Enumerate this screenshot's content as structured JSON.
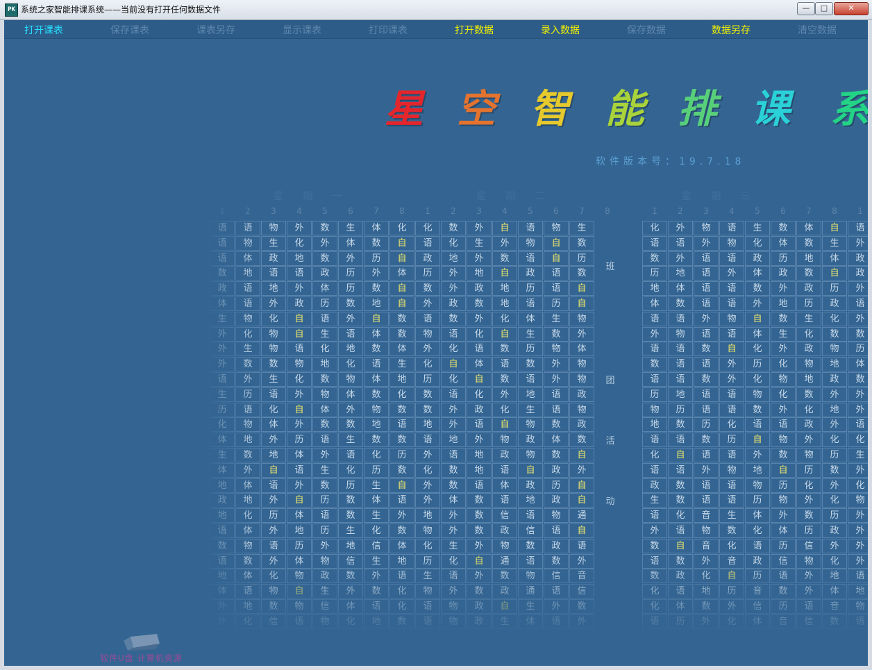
{
  "window": {
    "title": "系统之家智能排课系统——当前没有打开任何数据文件",
    "icon_label": "PK",
    "minimize_glyph": "—",
    "maximize_glyph": "□",
    "close_glyph": "✕"
  },
  "menu": [
    {
      "label": "打开课表",
      "enabled": true,
      "color": "#27e0ff"
    },
    {
      "label": "保存课表",
      "enabled": false,
      "color": "#5f87ad"
    },
    {
      "label": "课表另存",
      "enabled": false,
      "color": "#5f87ad"
    },
    {
      "label": "显示课表",
      "enabled": false,
      "color": "#5f87ad"
    },
    {
      "label": "打印课表",
      "enabled": false,
      "color": "#5f87ad"
    },
    {
      "label": "打开数据",
      "enabled": true,
      "color": "#f4f200"
    },
    {
      "label": "录入数据",
      "enabled": true,
      "color": "#f4f200"
    },
    {
      "label": "保存数据",
      "enabled": false,
      "color": "#5f87ad"
    },
    {
      "label": "数据另存",
      "enabled": true,
      "color": "#f4f200"
    },
    {
      "label": "清空数据",
      "enabled": false,
      "color": "#5f87ad"
    }
  ],
  "banner": {
    "chars": [
      "星",
      "空",
      "智",
      "能",
      "排",
      "课",
      "系"
    ],
    "colors": [
      "#e4262c",
      "#e3732f",
      "#e6c92c",
      "#a9d33a",
      "#58d07a",
      "#2ad2d8",
      "#23d486"
    ]
  },
  "version_text": "软件版本号：19.7.18",
  "schedule": {
    "days": [
      "星 期 一",
      "星 期 二",
      "星 期 三"
    ],
    "periods": [
      "1",
      "2",
      "3",
      "4",
      "5",
      "6",
      "7",
      "8",
      "1",
      "2",
      "3",
      "4",
      "5",
      "6",
      "7",
      "8",
      "1",
      "2",
      "3",
      "4",
      "5",
      "6",
      "7",
      "8",
      "1",
      "2"
    ],
    "vertical_label": [
      "班",
      "团",
      "活",
      "动"
    ],
    "highlight_subject": "自",
    "colors": {
      "normal": "#c7d8e8",
      "highlight": "#f1e86a"
    },
    "rows": [
      [
        "语",
        "语",
        "物",
        "外",
        "数",
        "生",
        "体",
        "化",
        "化",
        "数",
        "外",
        "自",
        "语",
        "物",
        "生",
        "",
        "化",
        "外",
        "物",
        "语",
        "生",
        "数",
        "体",
        "自",
        "语",
        "外"
      ],
      [
        "语",
        "物",
        "生",
        "化",
        "外",
        "体",
        "数",
        "自",
        "语",
        "化",
        "生",
        "外",
        "物",
        "自",
        "数",
        "",
        "语",
        "语",
        "外",
        "物",
        "化",
        "体",
        "数",
        "生",
        "外",
        "化"
      ],
      [
        "语",
        "体",
        "政",
        "地",
        "数",
        "外",
        "历",
        "自",
        "政",
        "地",
        "外",
        "数",
        "语",
        "自",
        "历",
        "",
        "数",
        "外",
        "语",
        "语",
        "政",
        "历",
        "地",
        "体",
        "政",
        "外"
      ],
      [
        "数",
        "地",
        "语",
        "语",
        "政",
        "历",
        "外",
        "体",
        "历",
        "外",
        "地",
        "自",
        "政",
        "语",
        "数",
        "",
        "历",
        "地",
        "语",
        "外",
        "体",
        "政",
        "数",
        "自",
        "政",
        "外"
      ],
      [
        "政",
        "语",
        "地",
        "外",
        "体",
        "历",
        "数",
        "自",
        "数",
        "外",
        "政",
        "地",
        "历",
        "语",
        "自",
        "",
        "地",
        "体",
        "语",
        "语",
        "数",
        "外",
        "政",
        "历",
        "外",
        "外"
      ],
      [
        "体",
        "语",
        "外",
        "政",
        "历",
        "数",
        "地",
        "自",
        "外",
        "政",
        "数",
        "地",
        "语",
        "历",
        "自",
        "",
        "体",
        "数",
        "语",
        "语",
        "外",
        "地",
        "历",
        "政",
        "语",
        "政"
      ],
      [
        "生",
        "物",
        "化",
        "自",
        "语",
        "外",
        "自",
        "数",
        "语",
        "数",
        "外",
        "化",
        "体",
        "生",
        "物",
        "",
        "语",
        "语",
        "外",
        "物",
        "自",
        "数",
        "生",
        "化",
        "外",
        "外"
      ],
      [
        "外",
        "化",
        "物",
        "自",
        "生",
        "语",
        "体",
        "数",
        "物",
        "语",
        "化",
        "自",
        "生",
        "数",
        "外",
        "",
        "外",
        "物",
        "语",
        "语",
        "体",
        "生",
        "化",
        "数",
        "数",
        "数"
      ],
      [
        "外",
        "生",
        "物",
        "语",
        "化",
        "地",
        "数",
        "体",
        "外",
        "化",
        "语",
        "数",
        "历",
        "物",
        "体",
        "",
        "语",
        "语",
        "数",
        "自",
        "化",
        "外",
        "政",
        "物",
        "历",
        "数"
      ],
      [
        "外",
        "数",
        "数",
        "物",
        "地",
        "化",
        "语",
        "生",
        "化",
        "自",
        "体",
        "语",
        "数",
        "外",
        "物",
        "",
        "数",
        "语",
        "语",
        "外",
        "历",
        "化",
        "物",
        "地",
        "体",
        "外"
      ],
      [
        "语",
        "外",
        "生",
        "化",
        "数",
        "物",
        "体",
        "地",
        "历",
        "化",
        "自",
        "数",
        "语",
        "外",
        "物",
        "",
        "语",
        "语",
        "数",
        "外",
        "化",
        "物",
        "地",
        "政",
        "数",
        "外"
      ],
      [
        "生",
        "历",
        "语",
        "外",
        "物",
        "体",
        "数",
        "化",
        "数",
        "语",
        "化",
        "外",
        "地",
        "语",
        "政",
        "",
        "历",
        "地",
        "语",
        "语",
        "物",
        "化",
        "数",
        "外",
        "外",
        "外"
      ],
      [
        "历",
        "语",
        "化",
        "自",
        "体",
        "外",
        "物",
        "数",
        "数",
        "外",
        "政",
        "化",
        "生",
        "语",
        "物",
        "",
        "物",
        "历",
        "语",
        "语",
        "数",
        "外",
        "化",
        "地",
        "外",
        "外"
      ],
      [
        "化",
        "物",
        "体",
        "外",
        "数",
        "数",
        "地",
        "语",
        "地",
        "外",
        "语",
        "自",
        "物",
        "数",
        "政",
        "",
        "地",
        "数",
        "历",
        "化",
        "语",
        "语",
        "政",
        "外",
        "语",
        "外"
      ],
      [
        "体",
        "地",
        "外",
        "历",
        "语",
        "生",
        "数",
        "数",
        "语",
        "地",
        "外",
        "物",
        "政",
        "体",
        "数",
        "",
        "语",
        "语",
        "数",
        "历",
        "自",
        "物",
        "外",
        "化",
        "化",
        "自"
      ],
      [
        "生",
        "数",
        "地",
        "体",
        "外",
        "语",
        "化",
        "历",
        "外",
        "语",
        "地",
        "政",
        "物",
        "数",
        "自",
        "",
        "化",
        "自",
        "语",
        "语",
        "外",
        "数",
        "物",
        "历",
        "生",
        "数"
      ],
      [
        "体",
        "外",
        "自",
        "语",
        "生",
        "化",
        "历",
        "数",
        "化",
        "数",
        "地",
        "语",
        "自",
        "政",
        "外",
        "",
        "语",
        "语",
        "外",
        "物",
        "地",
        "自",
        "历",
        "数",
        "外",
        "外"
      ],
      [
        "地",
        "体",
        "语",
        "外",
        "数",
        "历",
        "生",
        "自",
        "外",
        "数",
        "语",
        "体",
        "政",
        "历",
        "自",
        "",
        "政",
        "数",
        "语",
        "语",
        "物",
        "历",
        "化",
        "外",
        "化",
        "数"
      ],
      [
        "政",
        "地",
        "外",
        "自",
        "历",
        "数",
        "体",
        "语",
        "外",
        "体",
        "数",
        "语",
        "地",
        "政",
        "自",
        "",
        "生",
        "数",
        "语",
        "语",
        "历",
        "物",
        "外",
        "化",
        "物",
        "数"
      ],
      [
        "地",
        "化",
        "历",
        "体",
        "语",
        "数",
        "生",
        "外",
        "地",
        "外",
        "数",
        "信",
        "语",
        "物",
        "通",
        "",
        "语",
        "化",
        "音",
        "生",
        "体",
        "外",
        "数",
        "历",
        "外",
        "自"
      ],
      [
        "语",
        "体",
        "外",
        "地",
        "历",
        "生",
        "化",
        "数",
        "物",
        "外",
        "数",
        "政",
        "信",
        "语",
        "自",
        "",
        "外",
        "语",
        "物",
        "数",
        "化",
        "体",
        "历",
        "政",
        "外",
        "语"
      ],
      [
        "数",
        "物",
        "语",
        "历",
        "外",
        "地",
        "信",
        "体",
        "化",
        "生",
        "外",
        "物",
        "数",
        "政",
        "语",
        "",
        "数",
        "自",
        "音",
        "化",
        "语",
        "历",
        "信",
        "外",
        "外",
        "美"
      ],
      [
        "语",
        "数",
        "外",
        "体",
        "物",
        "信",
        "生",
        "地",
        "历",
        "化",
        "自",
        "通",
        "语",
        "数",
        "外",
        "",
        "语",
        "数",
        "外",
        "音",
        "政",
        "信",
        "物",
        "化",
        "外",
        "体"
      ],
      [
        "地",
        "体",
        "化",
        "物",
        "政",
        "数",
        "外",
        "语",
        "生",
        "语",
        "外",
        "数",
        "物",
        "信",
        "音",
        "",
        "数",
        "政",
        "化",
        "自",
        "历",
        "语",
        "外",
        "地",
        "语",
        "外"
      ],
      [
        "体",
        "语",
        "物",
        "自",
        "生",
        "外",
        "数",
        "化",
        "物",
        "外",
        "数",
        "政",
        "通",
        "语",
        "信",
        "",
        "化",
        "语",
        "地",
        "历",
        "音",
        "数",
        "外",
        "体",
        "地",
        "外"
      ],
      [
        "外",
        "地",
        "数",
        "物",
        "信",
        "体",
        "语",
        "化",
        "语",
        "物",
        "政",
        "自",
        "生",
        "外",
        "数",
        "",
        "化",
        "体",
        "数",
        "外",
        "信",
        "历",
        "语",
        "音",
        "物",
        "语"
      ],
      [
        "外",
        "化",
        "信",
        "语",
        "物",
        "化",
        "地",
        "数",
        "语",
        "物",
        "政",
        "生",
        "体",
        "语",
        "外",
        "",
        "语",
        "历",
        "外",
        "化",
        "体",
        "音",
        "信",
        "数",
        "语",
        "外"
      ]
    ]
  },
  "logo": {
    "text": "软件U盘  计算机资源"
  }
}
